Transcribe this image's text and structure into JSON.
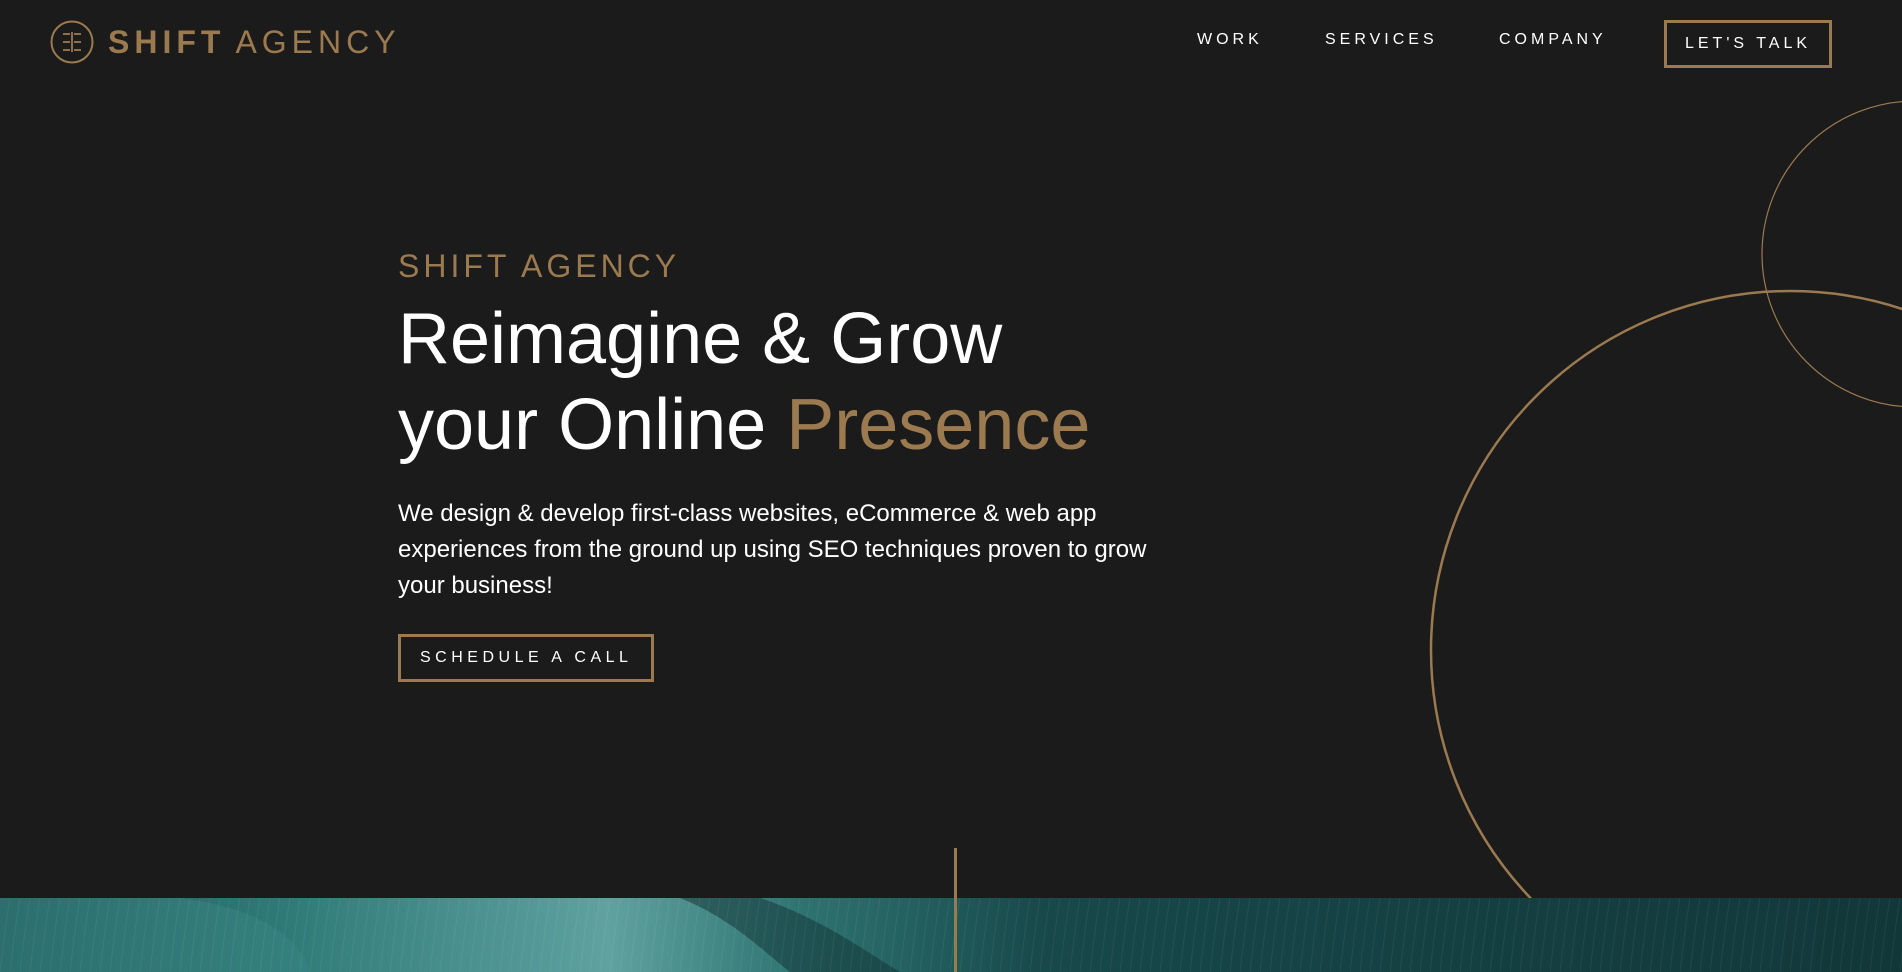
{
  "brand": {
    "name_bold": "SHIFT",
    "name_light": "AGENCY",
    "logo_icon": "shift-monogram-icon",
    "accent_color": "#9c7a50",
    "background_color": "#1b1b1b"
  },
  "nav": {
    "items": [
      {
        "label": "WORK"
      },
      {
        "label": "SERVICES"
      },
      {
        "label": "COMPANY"
      }
    ],
    "cta_label": "LET'S TALK"
  },
  "hero": {
    "eyebrow": "SHIFT AGENCY",
    "headline_line1": "Reimagine & Grow",
    "headline_line2_prefix": "your Online ",
    "headline_line2_accent": "Presence",
    "subcopy": "We design & develop first-class websites, eCommerce & web app experiences from the ground up using SEO techniques proven to grow your business!",
    "cta_label": "SCHEDULE A CALL"
  }
}
